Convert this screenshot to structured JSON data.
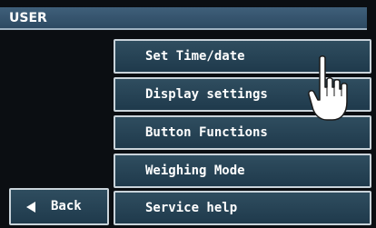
{
  "header": {
    "title": "USER"
  },
  "menu": {
    "items": [
      {
        "label": "Set Time/date"
      },
      {
        "label": "Display settings"
      },
      {
        "label": "Button Functions"
      },
      {
        "label": "Weighing Mode"
      },
      {
        "label": "Service help"
      }
    ]
  },
  "back": {
    "label": "Back",
    "icon": "left-triangle-icon"
  },
  "cursor": {
    "icon": "pointing-hand-icon"
  },
  "colors": {
    "title_bg": "#3f5f7a",
    "button_bg": "#2f4d5f",
    "button_border": "#c9d3da",
    "screen_bg": "#0b0e12"
  }
}
